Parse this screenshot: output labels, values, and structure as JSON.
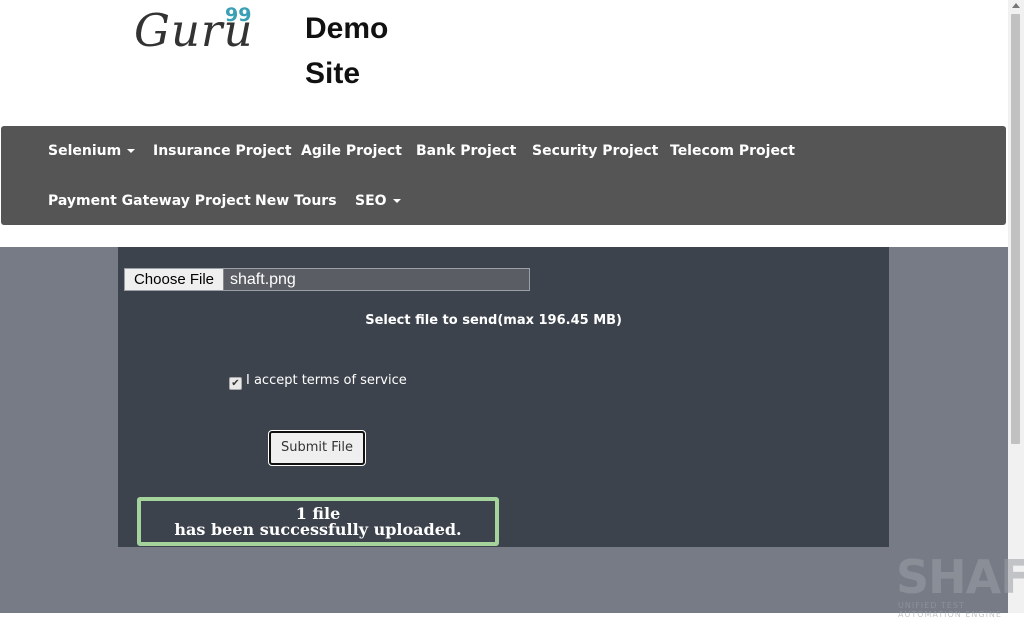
{
  "header": {
    "logo_text": "Guru",
    "logo_superscript": "99",
    "site_title_line1": "Demo",
    "site_title_line2": "Site"
  },
  "nav": {
    "row1": [
      {
        "label": "Selenium",
        "dropdown": true
      },
      {
        "label": "Insurance Project",
        "dropdown": false
      },
      {
        "label": "Agile Project",
        "dropdown": false
      },
      {
        "label": "Bank Project",
        "dropdown": false
      },
      {
        "label": "Security Project",
        "dropdown": false
      },
      {
        "label": "Telecom Project",
        "dropdown": false
      }
    ],
    "row2": [
      {
        "label": "Payment Gateway Project",
        "dropdown": false
      },
      {
        "label": "New Tours",
        "dropdown": false
      },
      {
        "label": "SEO",
        "dropdown": true
      }
    ]
  },
  "upload": {
    "choose_button_label": "Choose File",
    "selected_file": "shaft.png",
    "select_label": "Select file to send(max 196.45 MB)",
    "terms_label": "I accept terms of service",
    "terms_checked": true,
    "submit_label": "Submit File",
    "success_line1": "1 file",
    "success_line2": "has been successfully uploaded."
  },
  "watermark": {
    "text": "SHAFT",
    "subtext": "UNIFIED TEST AUTOMATION ENGINE"
  },
  "colors": {
    "navbar": "#555555",
    "panel": "#3c434c",
    "page_bg": "#777b86",
    "success_border": "#a4d39c",
    "logo_accent": "#3aa0b5"
  }
}
